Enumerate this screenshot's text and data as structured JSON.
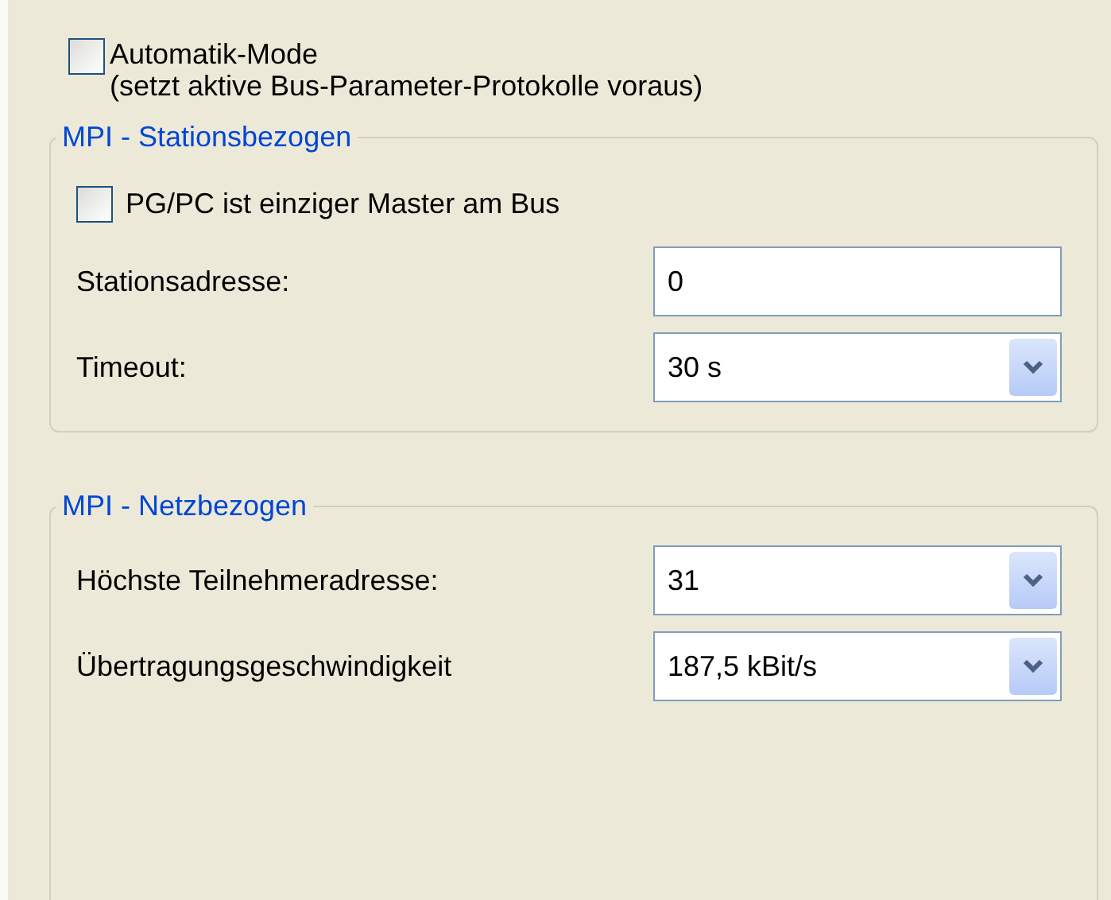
{
  "auto_mode": {
    "label": "Automatik-Mode",
    "note": "(setzt aktive Bus-Parameter-Protokolle voraus)",
    "checked": false
  },
  "groups": [
    {
      "title": "MPI - Stationsbezogen",
      "rows": [
        {
          "kind": "checkbox",
          "label": "PG/PC ist einziger Master am Bus",
          "checked": false
        },
        {
          "kind": "text",
          "label": "Stationsadresse:",
          "value": "0"
        },
        {
          "kind": "combo",
          "label": "Timeout:",
          "value": "30 s"
        }
      ]
    },
    {
      "title": "MPI - Netzbezogen",
      "rows": [
        {
          "kind": "combo",
          "label": "Höchste Teilnehmeradresse:",
          "value": "31"
        },
        {
          "kind": "combo",
          "label": "Übertragungsgeschwindigkeit",
          "value": "187,5 kBit/s"
        }
      ]
    }
  ]
}
